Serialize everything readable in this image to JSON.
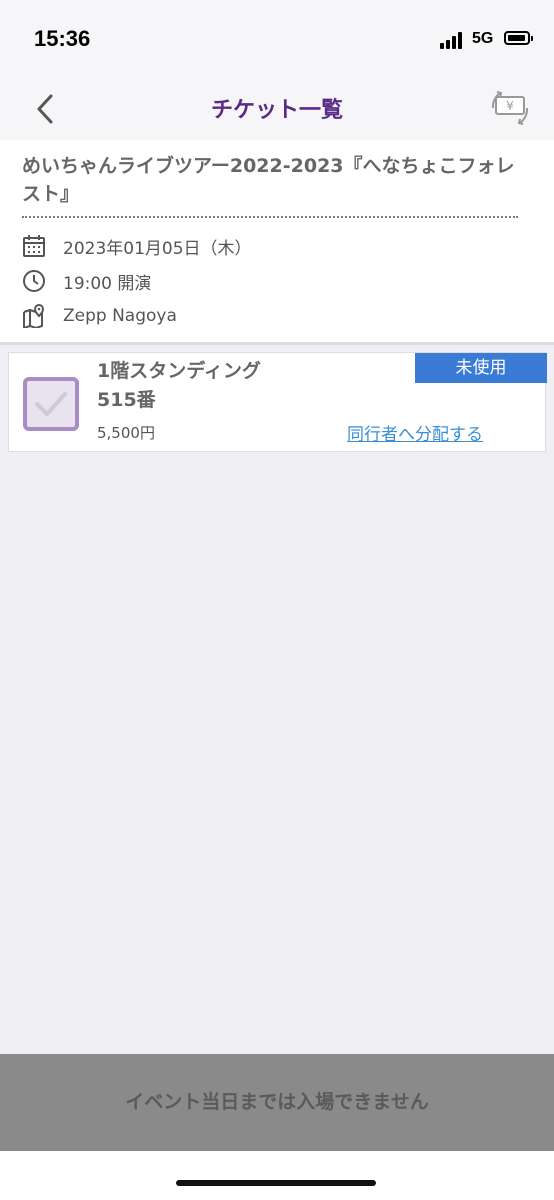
{
  "status_bar": {
    "time": "15:36",
    "network": "5G",
    "icons": [
      "signal-icon",
      "battery-icon"
    ]
  },
  "nav": {
    "title": "チケット一覧",
    "back_icon": "chevron-left-icon",
    "exchange_icon": "yen-exchange-icon"
  },
  "event": {
    "title": "めいちゃんライブツアー2022-2023『へなちょこフォレスト』",
    "date": "2023年01月05日（木）",
    "time": "19:00 開演",
    "venue": "Zepp Nagoya"
  },
  "ticket": {
    "seat_name": "1階スタンディング",
    "seat_number": "515番",
    "price": "5,500円",
    "status": "未使用",
    "share_link": "同行者へ分配する"
  },
  "footer": {
    "entry_message": "イベント当日までは入場できません"
  },
  "colors": {
    "accent": "#5a2a86",
    "badge": "#3a7bd5",
    "link": "#3a8ed6",
    "checkbox": "#a98bc6"
  }
}
